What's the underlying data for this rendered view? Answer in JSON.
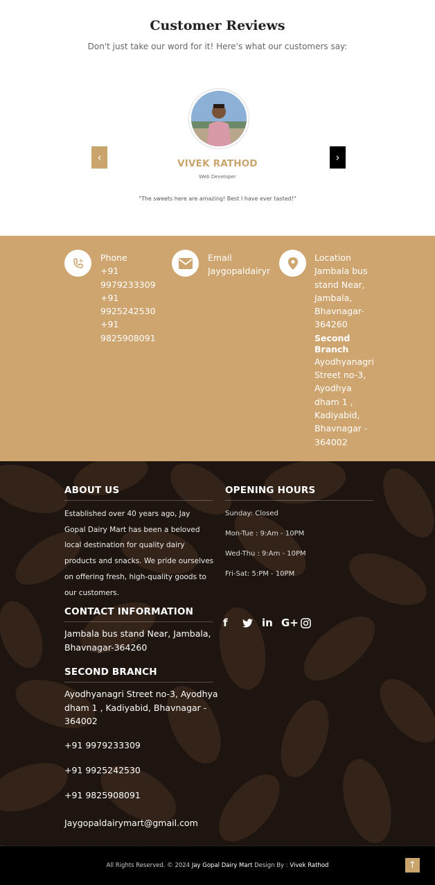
{
  "reviews": {
    "title": "Customer Reviews",
    "subtitle": "Don't just take our word for it! Here's what our customers say:",
    "prev_icon": "chevron-left-icon",
    "next_icon": "chevron-right-icon",
    "name": "VIVEK RATHOD",
    "role": "Web Developer",
    "quote": "\"The sweets here are amazing! Best I have ever tasted!\""
  },
  "contact": {
    "phone": {
      "icon": "phone-icon",
      "title": "Phone",
      "lines": [
        "+91",
        "9979233309",
        "+91",
        "9925242530",
        "+91",
        "9825908091"
      ]
    },
    "email": {
      "icon": "envelope-icon",
      "title": "Email",
      "value": "Jaygopaldairyr"
    },
    "location": {
      "icon": "map-marker-icon",
      "title": "Location",
      "lines": [
        "Jambala bus",
        "stand Near,",
        "Jambala,",
        "Bhavnagar-",
        "364260"
      ],
      "second_title_lines": [
        "Second",
        "Branch"
      ],
      "second_lines": [
        "Ayodhyanagri",
        "Street no-3,",
        "Ayodhya",
        "dham 1 ,",
        "Kadiyabid,",
        "Bhavnagar -",
        "364002"
      ]
    },
    "band_color": "#cfa56f"
  },
  "footer": {
    "about_title": "ABOUT US",
    "about_lines": [
      "Established over 40 years ago, Jay",
      "Gopal Dairy Mart has been a beloved",
      "local destination for quality dairy",
      "products and snacks. We pride ourselves",
      "on offering fresh, high-quality goods to",
      "our customers."
    ],
    "hours_title": "OPENING HOURS",
    "hours": [
      "Sunday: Closed",
      "Mon-Tue : 9:Am - 10PM",
      "Wed-Thu : 9:Am - 10PM",
      "Fri-Sat: 5:PM - 10PM"
    ],
    "contact_title": "CONTACT INFORMATION",
    "contact_lines": [
      "Jambala bus stand Near, Jambala,",
      "Bhavnagar-364260"
    ],
    "branch_title": "SECOND BRANCH",
    "branch_lines": [
      "Ayodhyanagri Street no-3, Ayodhya",
      "dham 1 , Kadiyabid, Bhavnagar -",
      "364002"
    ],
    "phones": [
      "+91 9979233309",
      "+91 9925242530",
      "+91 9825908091"
    ],
    "email": "Jaygopaldairymart@gmail.com",
    "social": [
      {
        "icon": "facebook-icon",
        "glyph": "f"
      },
      {
        "icon": "twitter-icon",
        "glyph": "🐦"
      },
      {
        "icon": "linkedin-icon",
        "glyph": "in"
      },
      {
        "icon": "google-plus-icon",
        "glyph": "G+"
      },
      {
        "icon": "instagram-icon",
        "glyph": "◎"
      }
    ]
  },
  "bottom": {
    "prefix": "All Rights Reserved. © 2024 ",
    "brand": "Jay Gopal Dairy Mart",
    "middle": " Design By : ",
    "designer": "Vivek Rathod",
    "to_top_icon": "arrow-up-icon"
  },
  "colors": {
    "accent": "#c9a46d",
    "bottom_bar": "#000000",
    "footer_bg": "#3a2a20"
  }
}
